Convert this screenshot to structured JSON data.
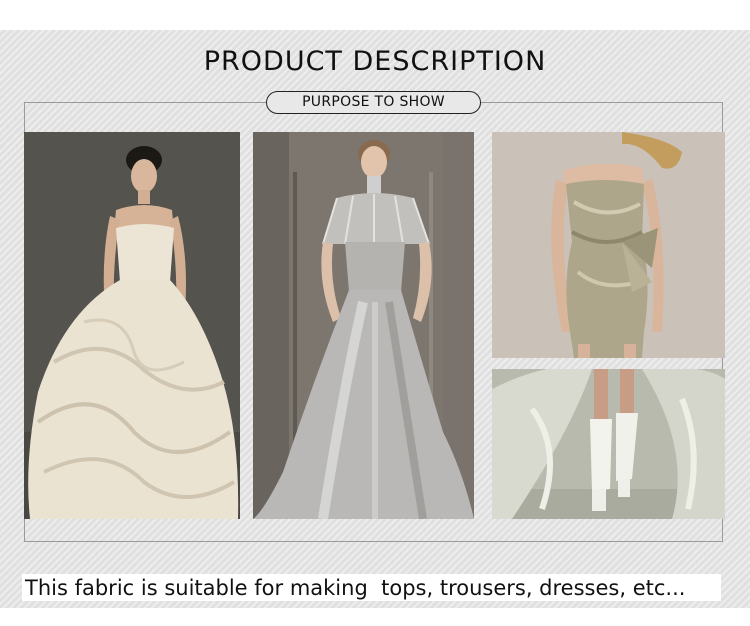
{
  "title": "PRODUCT DESCRIPTION",
  "subtitle": "PURPOSE TO SHOW",
  "caption": "This fabric is suitable for making  tops, trousers, dresses, etc...",
  "colors": {
    "band_background": "#e4e4e4",
    "frame_border": "#9a9a9a",
    "text": "#111111"
  }
}
